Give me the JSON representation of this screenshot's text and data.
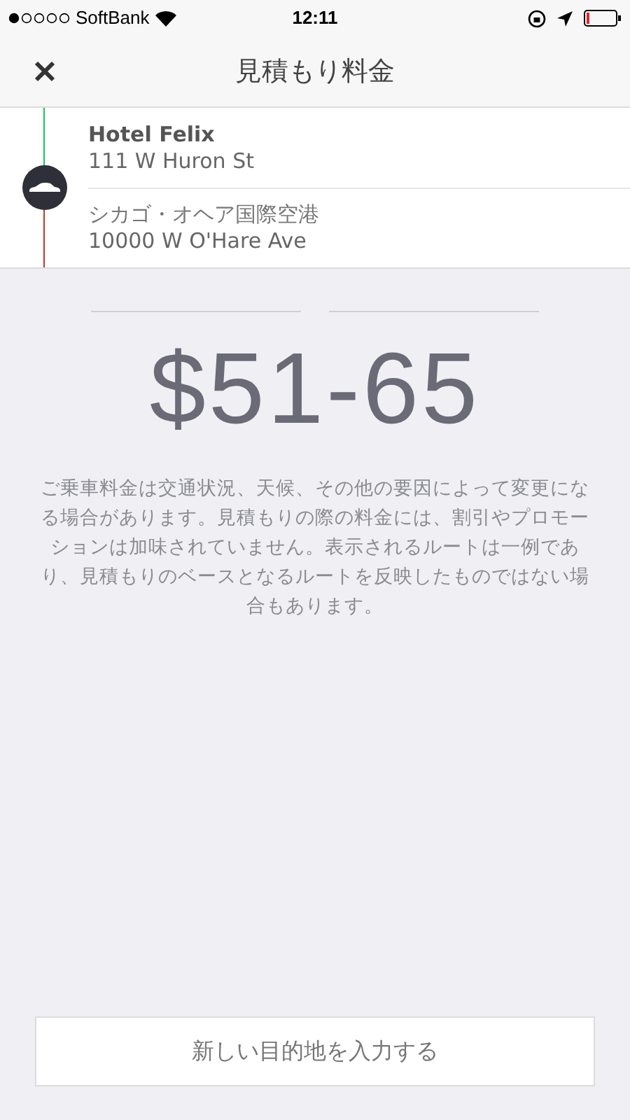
{
  "status_bar": {
    "carrier": "SoftBank",
    "time": "12:11"
  },
  "nav": {
    "title": "見積もり料金"
  },
  "route": [
    {
      "kind": "pickup",
      "name": "Hotel Felix",
      "address": "111 W Huron St"
    },
    {
      "kind": "dropoff",
      "name": "シカゴ・オヘア国際空港",
      "address": "10000 W O'Hare Ave"
    }
  ],
  "fare": {
    "price": "$51-65",
    "disclaimer": "ご乗車料金は交通状況、天候、その他の要因によって変更になる場合があります。見積もりの際の料金には、割引やプロモーションは加味されていません。表示されるルートは一例であり、見積もりのベースとなるルートを反映したものではない場合もあります。"
  },
  "action_button": "新しい目的地を入力する"
}
